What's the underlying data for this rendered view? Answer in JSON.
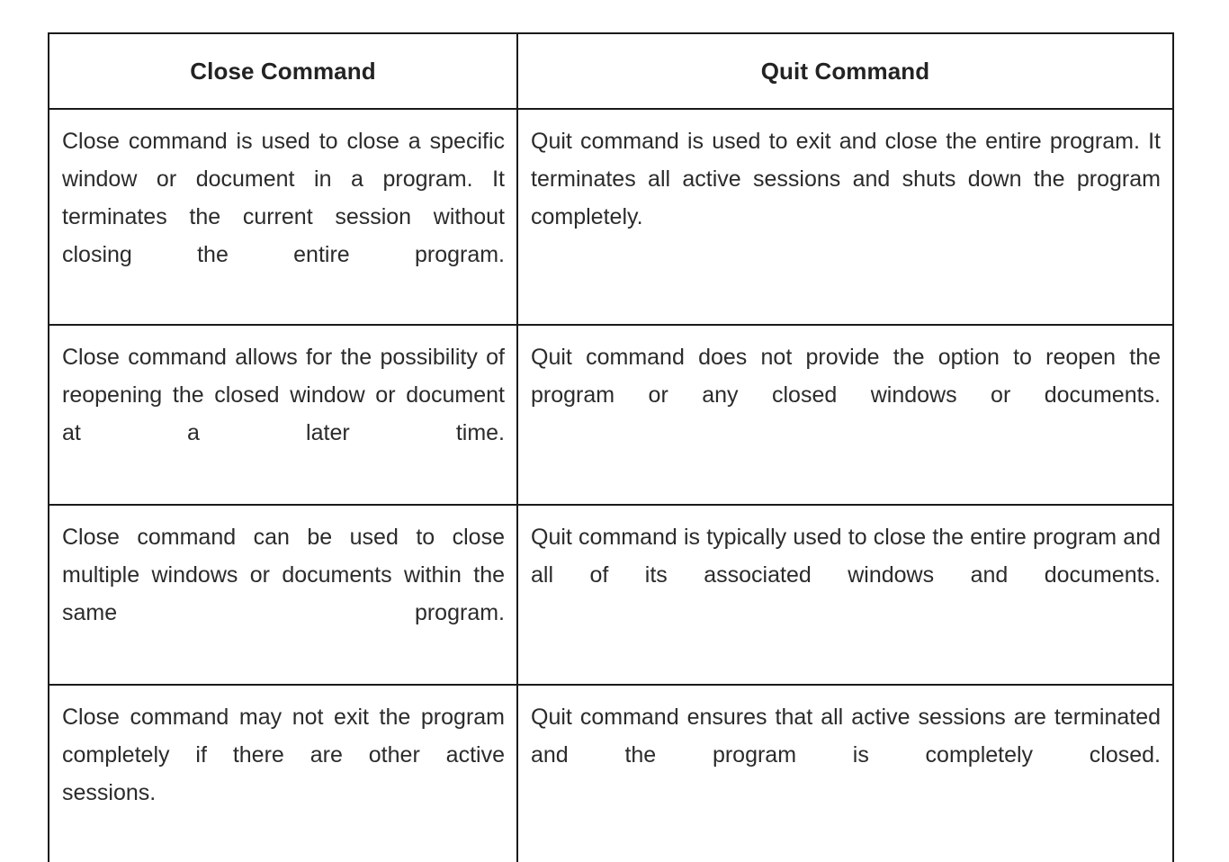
{
  "document": {
    "type": "comparison-table",
    "columns": [
      {
        "id": "close",
        "header": "Close Command"
      },
      {
        "id": "quit",
        "header": "Quit Command"
      }
    ],
    "rows": [
      {
        "close": "Close command is used to close a specific window or document in a program. It terminates the current session without closing the entire program.",
        "quit": "Quit command is used to exit and close the entire program. It terminates all active sessions and shuts down the program completely."
      },
      {
        "close": "Close command allows for the possibility of reopening the closed window or document at a later time.",
        "quit": "Quit command does not provide the option to reopen the program or any closed windows or documents."
      },
      {
        "close": "Close command can be used to close multiple windows or documents within the same program.",
        "quit": "Quit command is typically used to close the entire program and all of its associated windows and documents."
      },
      {
        "close": "Close command may not exit the program completely if there are other active sessions.",
        "quit": "Quit command ensures that all active sessions are terminated and the program is completely closed."
      }
    ]
  },
  "style": {
    "border_color": "#1a1a1a",
    "text_color": "#2b2b2b",
    "header_text_color": "#232323",
    "background_color": "#ffffff"
  }
}
